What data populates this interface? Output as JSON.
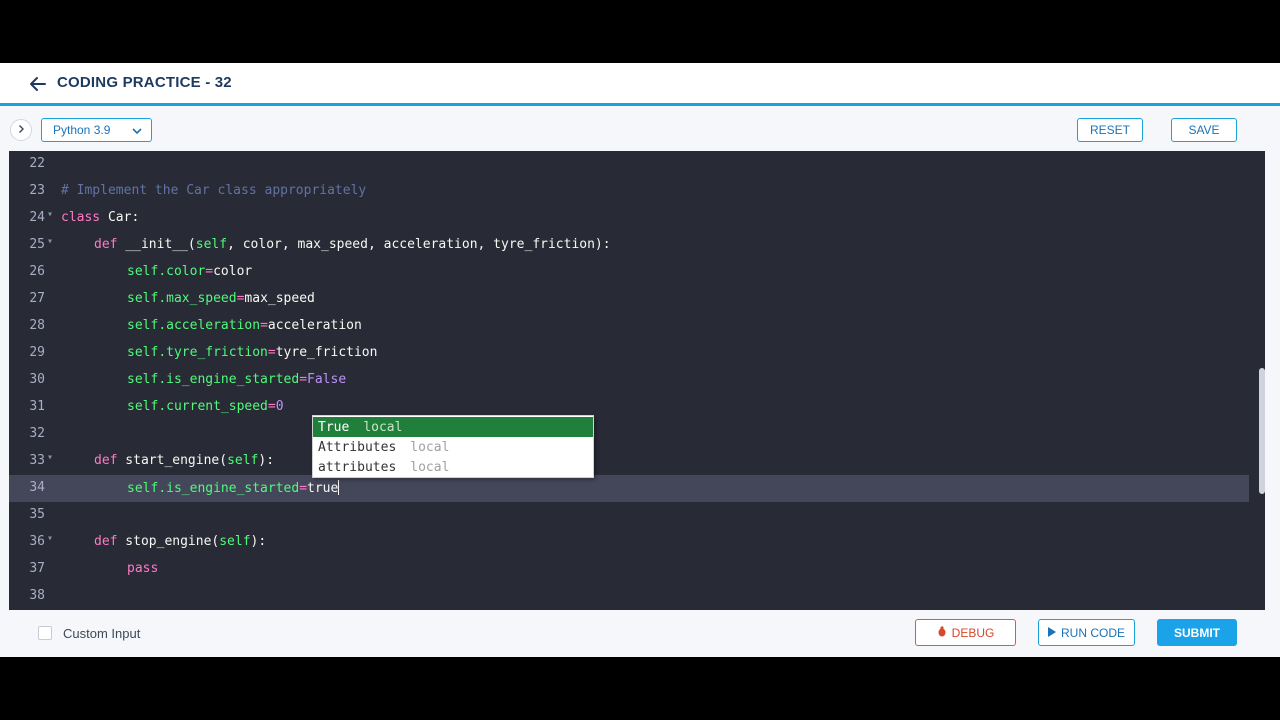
{
  "header": {
    "title": "CODING PRACTICE - 32",
    "back_icon": "arrow-left-icon"
  },
  "toolbar": {
    "language": "Python 3.9",
    "reset_label": "RESET",
    "save_label": "SAVE"
  },
  "editor": {
    "lines": [
      {
        "num": "22"
      },
      {
        "num": "23"
      },
      {
        "num": "24"
      },
      {
        "num": "25"
      },
      {
        "num": "26"
      },
      {
        "num": "27"
      },
      {
        "num": "28"
      },
      {
        "num": "29"
      },
      {
        "num": "30"
      },
      {
        "num": "31"
      },
      {
        "num": "32"
      },
      {
        "num": "33"
      },
      {
        "num": "34"
      },
      {
        "num": "35"
      },
      {
        "num": "36"
      },
      {
        "num": "37"
      },
      {
        "num": "38"
      }
    ],
    "code": {
      "l23": "# Implement the Car class appropriately",
      "l24_kw": "class",
      "l24_rest": " Car:",
      "l25_kw": "def",
      "l25_name": " __init__(",
      "l25_self": "self",
      "l25_rest": ", color, max_speed, acceleration, tyre_friction):",
      "l26_self": "self",
      "l26_attr": ".color",
      "l26_op": "=",
      "l26_val": "color",
      "l27_self": "self",
      "l27_attr": ".max_speed",
      "l27_op": "=",
      "l27_val": "max_speed",
      "l28_self": "self",
      "l28_attr": ".acceleration",
      "l28_op": "=",
      "l28_val": "acceleration",
      "l29_self": "self",
      "l29_attr": ".tyre_friction",
      "l29_op": "=",
      "l29_val": "tyre_friction",
      "l30_self": "self",
      "l30_attr": ".is_engine_started",
      "l30_op": "=",
      "l30_val": "False",
      "l31_self": "self",
      "l31_attr": ".current_speed",
      "l31_op": "=",
      "l31_val": "0",
      "l33_kw": "def",
      "l33_name": " start_engine(",
      "l33_self": "self",
      "l33_rest": "):",
      "l34_self": "self",
      "l34_attr": ".is_engine_started",
      "l34_op": "=",
      "l34_val": "true",
      "l36_kw": "def",
      "l36_name": " stop_engine(",
      "l36_self": "self",
      "l36_rest": "):",
      "l37_kw": "pass"
    },
    "active_line": "34"
  },
  "autocomplete": {
    "items": [
      {
        "label": "True",
        "meta": "local"
      },
      {
        "label": "Attributes",
        "meta": "local"
      },
      {
        "label": "attributes",
        "meta": "local"
      }
    ],
    "selected_index": 0
  },
  "footer": {
    "custom_input_label": "Custom Input",
    "custom_input_checked": false,
    "debug_label": "DEBUG",
    "run_label": "RUN CODE",
    "submit_label": "SUBMIT"
  },
  "colors": {
    "accent": "#1aa3d9",
    "editor_bg": "#282a36",
    "debug": "#e05a3a",
    "submit": "#1aa3e8",
    "autocomplete_selected": "#1f7f3b"
  }
}
